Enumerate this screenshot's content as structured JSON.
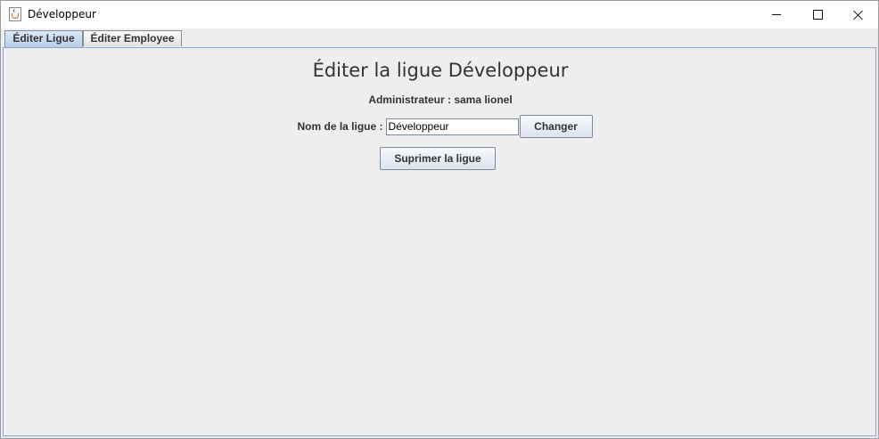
{
  "window": {
    "title": "Développeur"
  },
  "tabs": [
    {
      "label": "Éditer Ligue",
      "selected": true
    },
    {
      "label": "Éditer Employee",
      "selected": false
    }
  ],
  "main": {
    "heading": "Éditer la ligue Développeur",
    "admin_text": "Administrateur : sama lionel",
    "name_label": "Nom de la ligue :",
    "name_value": "Développeur",
    "change_button": "Changer",
    "delete_button": "Suprimer la ligue"
  }
}
